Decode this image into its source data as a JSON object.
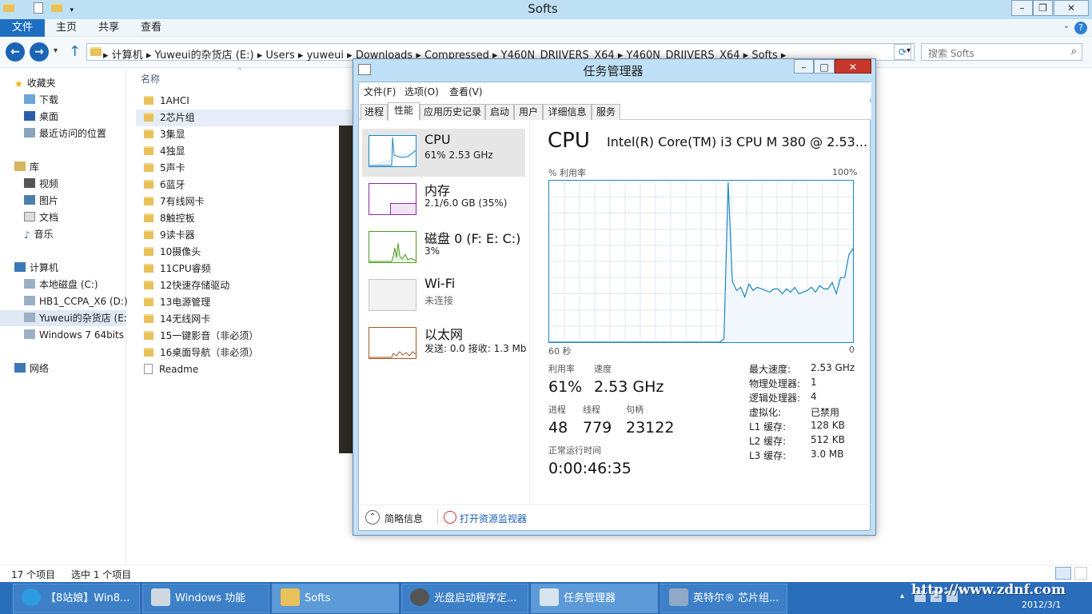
{
  "explorer": {
    "title": "Softs",
    "ribbon_tabs": {
      "file": "文件",
      "home": "主页",
      "share": "共享",
      "view": "查看"
    },
    "breadcrumbs": [
      "计算机",
      "Yuweui的杂货店 (E:)",
      "Users",
      "yuweui",
      "Downloads",
      "Compressed",
      "Y460N_DRIIVERS_X64",
      "Y460N_DRIIVERS_X64",
      "Softs"
    ],
    "search_placeholder": "搜索 Softs",
    "nav": {
      "favorites": "收藏夹",
      "downloads": "下载",
      "desktop": "桌面",
      "recent": "最近访问的位置",
      "libraries": "库",
      "videos": "视频",
      "pictures": "图片",
      "documents": "文档",
      "music": "音乐",
      "computer": "计算机",
      "drive_c": "本地磁盘 (C:)",
      "drive_d": "HB1_CCPA_X6 (D:)",
      "drive_e": "Yuweui的杂货店 (E:",
      "win7": "Windows 7 64bits",
      "network": "网络"
    },
    "column_name": "名称",
    "files": [
      "1AHCI",
      "2芯片组",
      "3集显",
      "4独显",
      "5声卡",
      "6蓝牙",
      "7有线网卡",
      "8触控板",
      "9读卡器",
      "10摄像头",
      "11CPU睿频",
      "12快速存储驱动",
      "13电源管理",
      "14无线网卡",
      "15一键影音（非必须）",
      "16桌面导航（非必须）",
      "Readme"
    ],
    "status_count": "17 个项目",
    "status_selected": "选中 1 个项目"
  },
  "taskmgr": {
    "title": "任务管理器",
    "menu": {
      "file": "文件(F)",
      "options": "选项(O)",
      "view": "查看(V)"
    },
    "tabs": {
      "processes": "进程",
      "performance": "性能",
      "app_history": "应用历史记录",
      "startup": "启动",
      "users": "用户",
      "details": "详细信息",
      "services": "服务"
    },
    "resources": {
      "cpu": {
        "name": "CPU",
        "value": "61%  2.53 GHz"
      },
      "memory": {
        "name": "内存",
        "value": "2.1/6.0 GB (35%)"
      },
      "disk": {
        "name": "磁盘 0 (F: E: C:)",
        "value": "3%"
      },
      "wifi": {
        "name": "Wi-Fi",
        "value": "未连接"
      },
      "ethernet": {
        "name": "以太网",
        "value": "发送: 0.0  接收: 1.3 Mb"
      }
    },
    "cpu_title": "CPU",
    "cpu_model": "Intel(R) Core(TM) i3 CPU M 380 @ 2.53...",
    "graph_label": "% 利用率",
    "graph_max": "100%",
    "graph_time": "60 秒",
    "graph_zero": "0",
    "stats": {
      "util_label": "利用率",
      "util": "61%",
      "speed_label": "速度",
      "speed": "2.53 GHz",
      "proc_label": "进程",
      "proc": "48",
      "thread_label": "线程",
      "thread": "779",
      "handle_label": "句柄",
      "handle": "23122",
      "uptime_label": "正常运行时间",
      "uptime": "0:00:46:35"
    },
    "details": [
      {
        "k": "最大速度:",
        "v": "2.53 GHz"
      },
      {
        "k": "物理处理器:",
        "v": "1"
      },
      {
        "k": "逻辑处理器:",
        "v": "4"
      },
      {
        "k": "虚拟化:",
        "v": "已禁用"
      },
      {
        "k": "L1 缓存:",
        "v": "128 KB"
      },
      {
        "k": "L2 缓存:",
        "v": "512 KB"
      },
      {
        "k": "L3 缓存:",
        "v": "3.0 MB"
      }
    ],
    "footer_brief": "简略信息",
    "footer_monitor": "打开资源监视器",
    "cpu_history": [
      0,
      0,
      0,
      0,
      0,
      0,
      0,
      0,
      0,
      0,
      0,
      0,
      0,
      0,
      0,
      0,
      0,
      0,
      0,
      0,
      0,
      0,
      0,
      0,
      0,
      0,
      0,
      0,
      0,
      0,
      0,
      0,
      0,
      0,
      0,
      0,
      0,
      0,
      0,
      0,
      0,
      0,
      0,
      0,
      0,
      0,
      0,
      0,
      0,
      0,
      0,
      0,
      0,
      0,
      0,
      0,
      0,
      0,
      0,
      0,
      0,
      0,
      0,
      0,
      0,
      0,
      0,
      0,
      0,
      0,
      0,
      0,
      0,
      0,
      0,
      0,
      0,
      0,
      0,
      0,
      0,
      0,
      0,
      0,
      0,
      0,
      0,
      0,
      0,
      0,
      0,
      0,
      0,
      0,
      0,
      0,
      0,
      0,
      0,
      0,
      0,
      0,
      0,
      0,
      0,
      0,
      0,
      0,
      0,
      0,
      0,
      0,
      0,
      0,
      0,
      0,
      0,
      0,
      0,
      0,
      0,
      0,
      0,
      0,
      0,
      0,
      0,
      0,
      0,
      0,
      0,
      0,
      0,
      0,
      0,
      0,
      0,
      0,
      0,
      0,
      0,
      0,
      0,
      0,
      0,
      0,
      0,
      0,
      0,
      0,
      0,
      0,
      0,
      0,
      0,
      0,
      0,
      0,
      0,
      0,
      0,
      0,
      0,
      0,
      0,
      0,
      0,
      0,
      0,
      0,
      0,
      0,
      0,
      0,
      0,
      0
    ]
  },
  "cpu_series": [
    0,
    0,
    0,
    0,
    0,
    0,
    0,
    0,
    0,
    0,
    0,
    0,
    0,
    0,
    0,
    0,
    0,
    0,
    0,
    0,
    0,
    0,
    0,
    0,
    0,
    0,
    0,
    0,
    0,
    0,
    0,
    0,
    0,
    0,
    0,
    0,
    0,
    0,
    0,
    0,
    0,
    0,
    2,
    99,
    38,
    32,
    34,
    28,
    36,
    32,
    34,
    33,
    32,
    31,
    33,
    33,
    30,
    33,
    31,
    34,
    30,
    31,
    32,
    34,
    31,
    35,
    33,
    33,
    37,
    30,
    40,
    40,
    54,
    58
  ],
  "taskbar": {
    "items": [
      "【8站娘】Win8...",
      "Windows 功能",
      "Softs",
      "光盘启动程序定...",
      "任务管理器",
      "英特尔® 芯片组..."
    ],
    "date": "2012/3/1",
    "watermark": "http://www.zdnf.com"
  }
}
